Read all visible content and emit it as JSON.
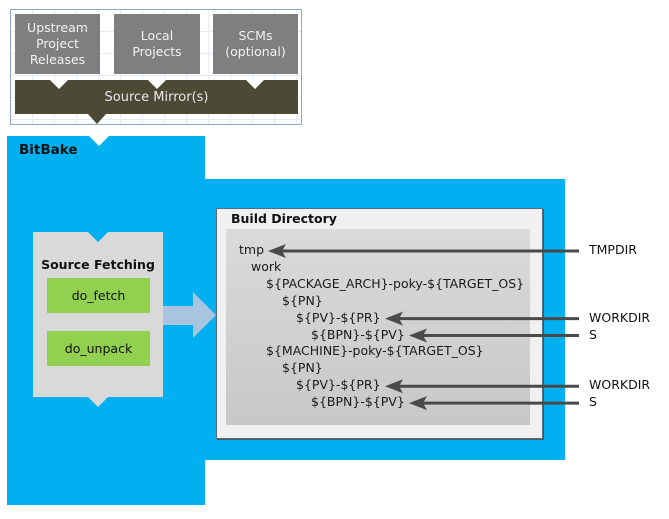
{
  "sources": {
    "boxes": [
      {
        "lines": [
          "Upstream",
          "Project",
          "Releases"
        ]
      },
      {
        "lines": [
          "Local",
          "Projects"
        ]
      },
      {
        "lines": [
          "SCMs",
          "(optional)"
        ]
      }
    ],
    "mirror_label": "Source Mirror(s)"
  },
  "bitbake": {
    "title": "BitBake",
    "source_fetching": {
      "title": "Source Fetching",
      "tasks": [
        "do_fetch",
        "do_unpack"
      ]
    },
    "build_directory": {
      "title": "Build Directory",
      "tree": [
        {
          "text": "tmp",
          "depth": 0
        },
        {
          "text": "work",
          "depth": 1
        },
        {
          "text": "${PACKAGE_ARCH}-poky-${TARGET_OS}",
          "depth": 2
        },
        {
          "text": "${PN}",
          "depth": 3
        },
        {
          "text": "${PV}-${PR}",
          "depth": 4
        },
        {
          "text": "${BPN}-${PV}",
          "depth": 5
        },
        {
          "text": "${MACHINE}-poky-${TARGET_OS}",
          "depth": 2
        },
        {
          "text": "${PN}",
          "depth": 3
        },
        {
          "text": "${PV}-${PR}",
          "depth": 4
        },
        {
          "text": "${BPN}-${PV}",
          "depth": 5
        }
      ]
    }
  },
  "variable_labels": [
    {
      "label": "TMPDIR",
      "points_to_row": 0
    },
    {
      "label": "WORKDIR",
      "points_to_row": 4
    },
    {
      "label": "S",
      "points_to_row": 5
    },
    {
      "label": "WORKDIR",
      "points_to_row": 8
    },
    {
      "label": "S",
      "points_to_row": 9
    }
  ],
  "colors": {
    "bitbake_blue": "#00b0f0",
    "source_box_gray": "#7f7f7f",
    "mirror_olive": "#4a4a35",
    "task_green": "#92d050",
    "flow_arrow": "#a9c4e0",
    "pointer_arrow": "#4a4a4a"
  }
}
